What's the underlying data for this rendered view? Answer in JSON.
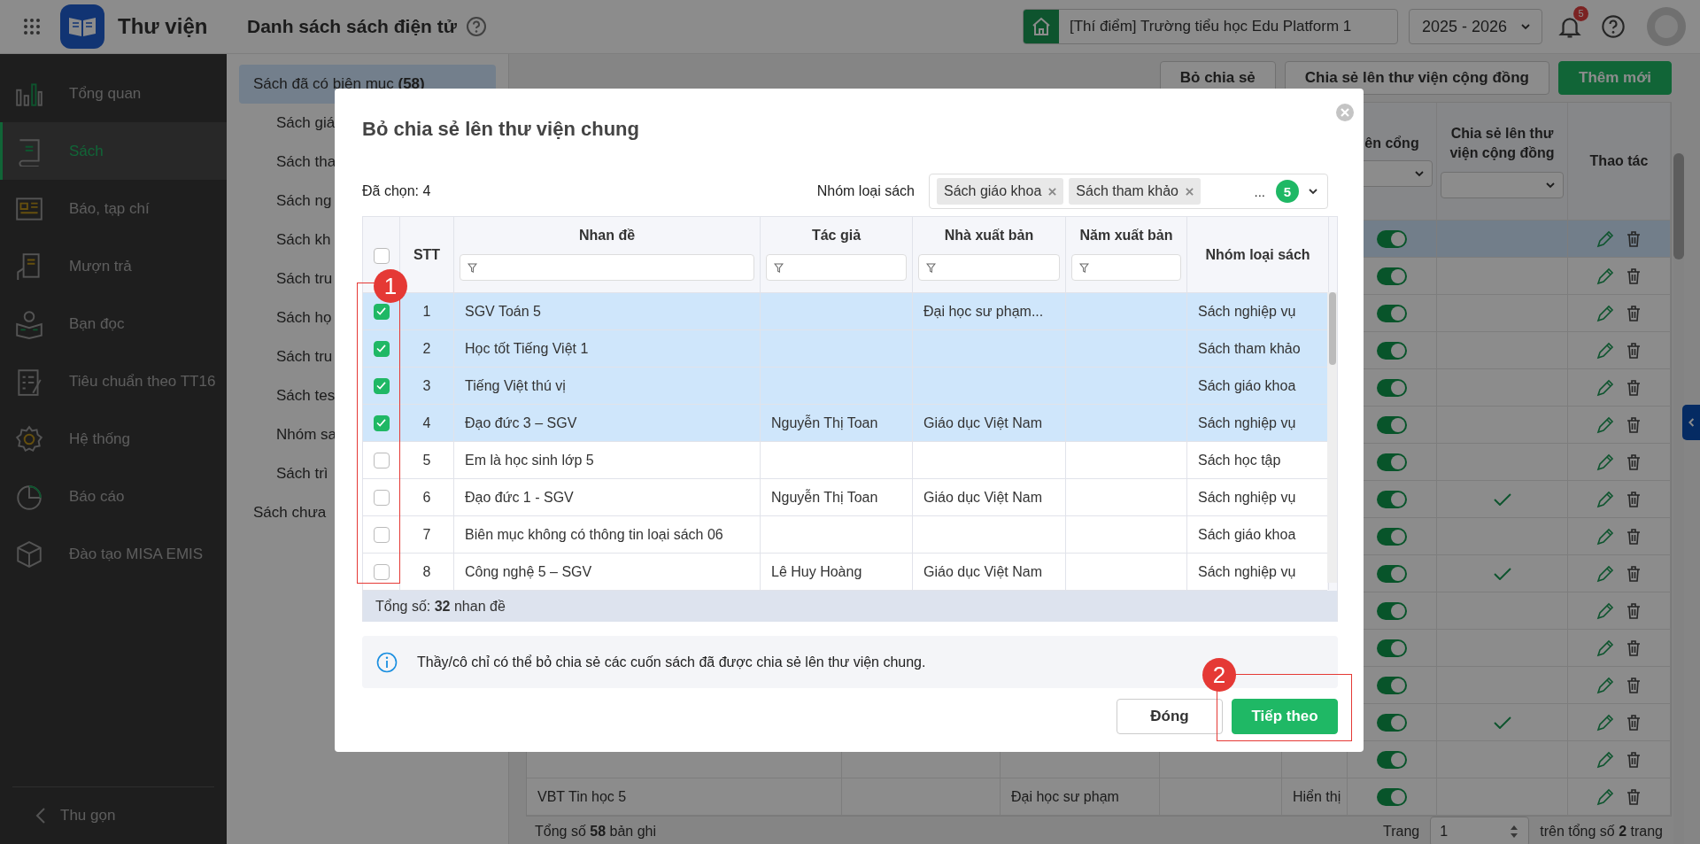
{
  "app": {
    "title": "Thư viện"
  },
  "page_title": "Danh sách sách điện tử",
  "header": {
    "school": "[Thí điểm] Trường tiểu học Edu Platform 1",
    "year": "2025 - 2026",
    "notification_count": "5"
  },
  "sidebar": {
    "items": [
      {
        "label": "Tổng quan",
        "selected": false
      },
      {
        "label": "Sách",
        "selected": true
      },
      {
        "label": "Báo, tạp chí",
        "selected": false
      },
      {
        "label": "Mượn trả",
        "selected": false
      },
      {
        "label": "Bạn đọc",
        "selected": false
      },
      {
        "label": "Tiêu chuẩn theo TT16",
        "selected": false
      },
      {
        "label": "Hệ thống",
        "selected": false
      },
      {
        "label": "Báo cáo",
        "selected": false
      },
      {
        "label": "Đào tạo MISA EMIS",
        "selected": false
      }
    ],
    "collapse": "Thu gọn"
  },
  "subnav": [
    {
      "label": "Sách đã có biên mục **(58)**",
      "selected": true,
      "children": [
        "Sách giá",
        "Sách tha",
        "Sách ng",
        "Sách kh",
        "Sách tru",
        "Sách họ",
        "Sách tru",
        "Sách tes",
        "Nhóm sa",
        "Sách trì"
      ]
    },
    {
      "label": "Sách chưa",
      "selected": false
    }
  ],
  "toolbar": [
    {
      "label": "Bỏ chia sẻ",
      "kind": "default"
    },
    {
      "label": "Chia sẻ lên thư viện cộng đồng",
      "kind": "default"
    },
    {
      "label": "Thêm mới",
      "kind": "primary"
    }
  ],
  "background_table": {
    "columns": [
      "ên cổng",
      "Chia sẻ lên thư viện cộng đồng",
      "Thao tác"
    ],
    "rows": [
      {
        "selected": true,
        "on": true,
        "shared": false
      },
      {
        "selected": false,
        "on": true,
        "shared": false
      },
      {
        "selected": false,
        "on": true,
        "shared": false
      },
      {
        "selected": false,
        "on": true,
        "shared": false
      },
      {
        "selected": false,
        "on": true,
        "shared": false
      },
      {
        "selected": false,
        "on": true,
        "shared": false
      },
      {
        "selected": false,
        "on": true,
        "shared": false
      },
      {
        "selected": false,
        "on": true,
        "shared": true
      },
      {
        "selected": false,
        "on": true,
        "shared": false
      },
      {
        "selected": false,
        "on": true,
        "shared": true
      },
      {
        "selected": false,
        "on": true,
        "shared": false
      },
      {
        "selected": false,
        "on": true,
        "shared": false
      },
      {
        "selected": false,
        "on": true,
        "shared": false
      },
      {
        "selected": false,
        "on": true,
        "shared": true
      },
      {
        "selected": false,
        "on": true,
        "shared": false
      },
      {
        "selected": false,
        "on": true,
        "shared": false,
        "title": "VBT Tin học 5",
        "publisher": "Đại học sư phạm",
        "status": "Hiển thị"
      }
    ]
  },
  "footer": {
    "total": "Tổng số **58** bản ghi",
    "page_label": "Trang",
    "page": "1",
    "page_total": "trên tổng số **2** trang"
  },
  "dialog": {
    "title": "Bỏ chia sẻ lên thư viện chung",
    "selected_count": "Đã chọn: 4",
    "filter_label": "Nhóm loại sách",
    "filter_tags": [
      "Sách giáo khoa",
      "Sách tham khảo"
    ],
    "filter_more": "...",
    "filter_count": "5",
    "table": {
      "all_selected": false,
      "columns": [
        {
          "label": "STT",
          "filter": false
        },
        {
          "label": "Nhan đề",
          "filter": true
        },
        {
          "label": "Tác giả",
          "filter": true
        },
        {
          "label": "Nhà xuất bản",
          "filter": true
        },
        {
          "label": "Năm xuất bản",
          "filter": true
        },
        {
          "label": "Nhóm loại sách",
          "filter": false
        }
      ],
      "rows": [
        {
          "selected": true,
          "cells": [
            "1",
            "SGV Toán 5",
            "",
            "Đại học sư phạm...",
            "",
            "Sách nghiệp vụ"
          ]
        },
        {
          "selected": true,
          "cells": [
            "2",
            "Học tốt Tiếng Việt 1",
            "",
            "",
            "",
            "Sách tham khảo"
          ]
        },
        {
          "selected": true,
          "cells": [
            "3",
            "Tiếng Việt thú vị",
            "",
            "",
            "",
            "Sách giáo khoa"
          ]
        },
        {
          "selected": true,
          "cells": [
            "4",
            "Đạo đức 3 – SGV",
            "Nguyễn Thị Toan",
            "Giáo dục Việt Nam",
            "",
            "Sách nghiệp vụ"
          ]
        },
        {
          "selected": false,
          "cells": [
            "5",
            "Em là học sinh lớp 5",
            "",
            "",
            "",
            "Sách học tập"
          ]
        },
        {
          "selected": false,
          "cells": [
            "6",
            "Đạo đức 1 - SGV",
            "Nguyễn Thị Toan",
            "Giáo dục Việt Nam",
            "",
            "Sách nghiệp vụ"
          ]
        },
        {
          "selected": false,
          "cells": [
            "7",
            "Biên mục không có thông tin loại sách 06",
            "",
            "",
            "",
            "Sách giáo khoa"
          ]
        },
        {
          "selected": false,
          "cells": [
            "8",
            "Công nghệ 5 – SGV",
            "Lê Huy Hoàng",
            "Giáo dục Việt Nam",
            "",
            "Sách nghiệp vụ"
          ]
        }
      ],
      "total": "Tổng số: **32** nhan đề"
    },
    "info": "Thầy/cô chỉ có thể bỏ chia sẻ các cuốn sách đã được chia sẻ lên thư viện chung.",
    "buttons": [
      {
        "label": "Đóng",
        "kind": "default"
      },
      {
        "label": "Tiếp theo",
        "kind": "primary"
      }
    ]
  },
  "annotations": [
    {
      "label": "1"
    },
    {
      "label": "2"
    }
  ]
}
